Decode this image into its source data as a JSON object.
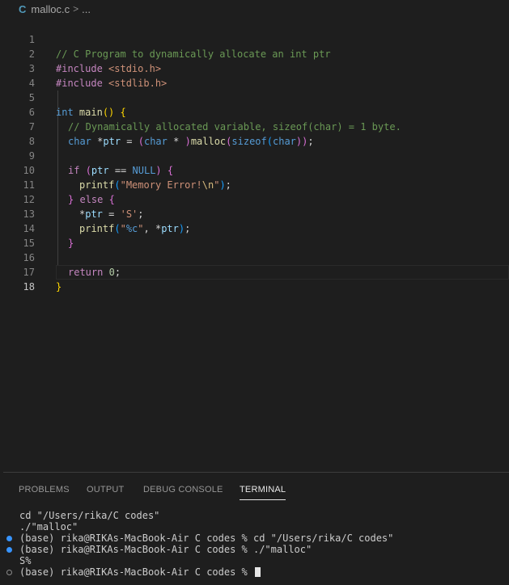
{
  "breadcrumb": {
    "file": "malloc.c",
    "separator": ">",
    "more": "..."
  },
  "icons": {
    "file_type": "c-language-icon"
  },
  "editor": {
    "lines": [
      {
        "n": "1"
      },
      {
        "n": "2"
      },
      {
        "n": "3"
      },
      {
        "n": "4"
      },
      {
        "n": "5"
      },
      {
        "n": "6"
      },
      {
        "n": "7"
      },
      {
        "n": "8"
      },
      {
        "n": "9"
      },
      {
        "n": "10"
      },
      {
        "n": "11"
      },
      {
        "n": "12"
      },
      {
        "n": "13"
      },
      {
        "n": "14"
      },
      {
        "n": "15"
      },
      {
        "n": "16"
      },
      {
        "n": "17"
      },
      {
        "n": "18"
      }
    ],
    "tokens": {
      "l1": "// C Program to dynamically allocate an int ptr",
      "l2a": "#include",
      "l2b": "<stdio.h>",
      "l3a": "#include",
      "l3b": "<stdlib.h>",
      "l5a": "int",
      "l5b": "main",
      "l5c": "()",
      "l5d": "{",
      "l6": "// Dynamically allocated variable, sizeof(char) = 1 byte.",
      "l7a": "char",
      "l7b": "*",
      "l7c": "ptr",
      "l7d": " = ",
      "l7e": "(",
      "l7f": "char",
      "l7g": " * ",
      "l7h": ")",
      "l7i": "malloc",
      "l7j": "(",
      "l7k": "sizeof",
      "l7l": "(",
      "l7m": "char",
      "l7n": "))",
      "l7o": ";",
      "l9a": "if",
      "l9b": "(",
      "l9c": "ptr",
      "l9d": " == ",
      "l9e": "NULL",
      "l9f": ")",
      "l9g": "{",
      "l10a": "printf",
      "l10b": "(",
      "l10c": "\"Memory Error!",
      "l10d": "\\n",
      "l10e": "\"",
      "l10f": ")",
      "l10g": ";",
      "l11a": "}",
      "l11b": "else",
      "l11c": "{",
      "l12a": "*",
      "l12b": "ptr",
      "l12c": " = ",
      "l12d": "'S'",
      "l12e": ";",
      "l13a": "printf",
      "l13b": "(",
      "l13c": "\"",
      "l13d": "%c",
      "l13e": "\"",
      "l13f": ", *",
      "l13g": "ptr",
      "l13h": ")",
      "l13i": ";",
      "l14": "}",
      "l16a": "return",
      "l16b": "0",
      "l16c": ";",
      "l17": "}"
    }
  },
  "panel": {
    "tabs": [
      "PROBLEMS",
      "OUTPUT",
      "DEBUG CONSOLE",
      "TERMINAL"
    ],
    "active_tab": "TERMINAL",
    "terminal": [
      {
        "text": "cd \"/Users/rika/C codes\"",
        "marker": "none"
      },
      {
        "text": "./\"malloc\"",
        "marker": "none"
      },
      {
        "text": "(base) rika@RIKAs-MacBook-Air C codes % cd \"/Users/rika/C codes\"",
        "marker": "blue"
      },
      {
        "text": "(base) rika@RIKAs-MacBook-Air C codes % ./\"malloc\"",
        "marker": "blue"
      },
      {
        "text": "S%",
        "marker": "none"
      },
      {
        "text": "(base) rika@RIKAs-MacBook-Air C codes % ",
        "marker": "hollow"
      }
    ]
  },
  "colors": {
    "background": "#1e1e1e",
    "accent_blue": "#3794ff",
    "comment": "#6a9955",
    "keyword": "#569cd6",
    "preprocessor": "#c586c0",
    "string": "#ce9178"
  }
}
